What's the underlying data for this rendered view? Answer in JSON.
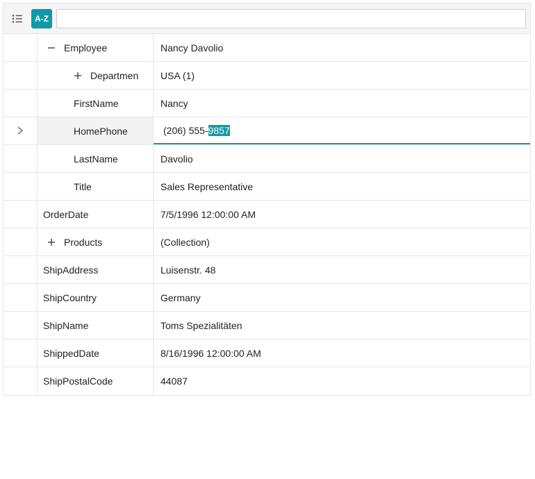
{
  "toolbar": {
    "sort_label": "A-Z",
    "search_placeholder": ""
  },
  "rows": {
    "employee": {
      "label": "Employee",
      "value": "Nancy Davolio"
    },
    "department": {
      "label": "Departmen",
      "value": "USA (1)"
    },
    "firstname": {
      "label": "FirstName",
      "value": "Nancy"
    },
    "homephone": {
      "label": "HomePhone",
      "value": "(206) 555-9857",
      "pre": "(206) 555-",
      "sel": "9857"
    },
    "lastname": {
      "label": "LastName",
      "value": "Davolio"
    },
    "title": {
      "label": "Title",
      "value": "Sales Representative"
    },
    "orderdate": {
      "label": "OrderDate",
      "value": "7/5/1996 12:00:00 AM"
    },
    "products": {
      "label": "Products",
      "value": "(Collection)"
    },
    "shipaddress": {
      "label": "ShipAddress",
      "value": "Luisenstr. 48"
    },
    "shipcountry": {
      "label": "ShipCountry",
      "value": "Germany"
    },
    "shipname": {
      "label": "ShipName",
      "value": "Toms Spezialitäten"
    },
    "shippeddate": {
      "label": "ShippedDate",
      "value": "8/16/1996 12:00:00 AM"
    },
    "shippostal": {
      "label": "ShipPostalCode",
      "value": "44087"
    }
  }
}
